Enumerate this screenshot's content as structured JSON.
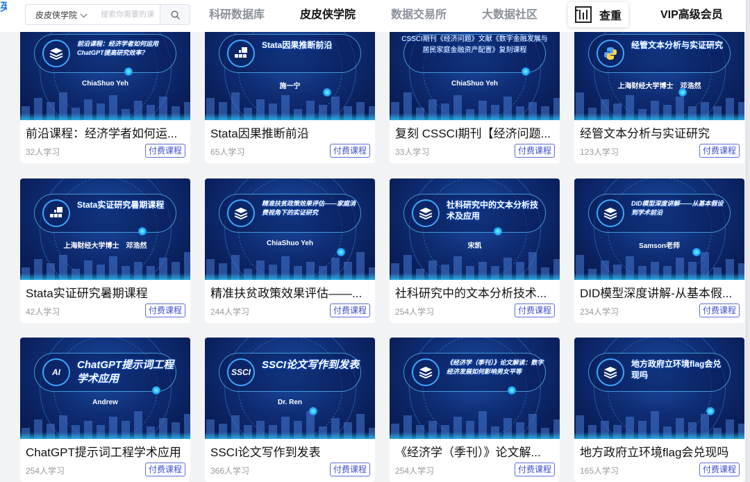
{
  "header": {
    "logo_fragment": "英入",
    "site_select": "皮皮侠学院",
    "search_placeholder": "搜索你需要的课",
    "nav": {
      "research": "科研数据库",
      "academy": "皮皮侠学院",
      "data_market": "数据交易所",
      "community": "大数据社区",
      "check": "查重",
      "vip": "VIP高级会员"
    }
  },
  "colors": {
    "accent_blue": "#3c4fc8",
    "thumb_dark": "#07164a",
    "thumb_light": "#1c4fa8"
  },
  "courses": [
    {
      "thumb_title": "前沿课程：经济学者如何运用ChatGPT提高研究效率？",
      "thumb_author": "ChiaShuo Yeh",
      "icon": "layers-icon",
      "title": "前沿课程：经济学者如何运...",
      "learners": "32人学习",
      "tag": "付费课程"
    },
    {
      "thumb_title": "Stata因果推断前沿",
      "thumb_author": "施一宁",
      "icon": "grid-icon",
      "title": "Stata因果推断前沿",
      "learners": "65人学习",
      "tag": "付费课程"
    },
    {
      "thumb_title": "CSSCI期刊《经济问题》文献《数字金融发展与居民家庭金融资产配置》复刻课程",
      "thumb_author": "ChiaShuo Yeh",
      "icon": "",
      "title": "复刻 CSSCI期刊【经济问题...",
      "learners": "33人学习",
      "tag": "付费课程"
    },
    {
      "thumb_title": "经管文本分析与实证研究",
      "thumb_author": "上海财经大学博士　邓浩然",
      "icon": "python-icon",
      "title": "经管文本分析与实证研究",
      "learners": "123人学习",
      "tag": "付费课程"
    },
    {
      "thumb_title": "Stata实证研究暑期课程",
      "thumb_author": "上海财经大学博士　邓浩然",
      "icon": "grid-icon",
      "title": "Stata实证研究暑期课程",
      "learners": "42人学习",
      "tag": "付费课程"
    },
    {
      "thumb_title": "精准扶贫政策效果评估——家庭消费视角下的实证研究",
      "thumb_author": "ChiaShuo Yeh",
      "icon": "layers-icon",
      "title": "精准扶贫政策效果评估——...",
      "learners": "244人学习",
      "tag": "付费课程"
    },
    {
      "thumb_title": "社科研究中的文本分析技术及应用",
      "thumb_author": "宋凯",
      "icon": "layers-icon",
      "title": "社科研究中的文本分析技术...",
      "learners": "254人学习",
      "tag": "付费课程"
    },
    {
      "thumb_title": "DID模型深度讲解——从基本假设到学术前沿",
      "thumb_author": "Samson老师",
      "icon": "layers-icon",
      "title": "DID模型深度讲解-从基本假...",
      "learners": "234人学习",
      "tag": "付费课程"
    },
    {
      "thumb_title": "ChatGPT提示词工程学术应用",
      "thumb_author": "Andrew",
      "icon": "ai-icon",
      "badge_text": "AI",
      "title": "ChatGPT提示词工程学术应用",
      "learners": "254人学习",
      "tag": "付费课程"
    },
    {
      "thumb_title": "SSCI论文写作到发表",
      "thumb_author": "Dr. Ren",
      "icon": "ssci-icon",
      "badge_text": "SSCI",
      "title": "SSCI论文写作到发表",
      "learners": "366人学习",
      "tag": "付费课程"
    },
    {
      "thumb_title": "《经济学（季刊）》论文解读：数字经济发展如何影响男女平等",
      "thumb_author": "",
      "icon": "layers-icon",
      "title": "《经济学（季刊）》论文解...",
      "learners": "254人学习",
      "tag": "付费课程"
    },
    {
      "thumb_title": "地方政府立环境flag会兑现吗",
      "thumb_author": "",
      "icon": "layers-icon",
      "title": "地方政府立环境flag会兑现吗",
      "learners": "165人学习",
      "tag": "付费课程"
    }
  ]
}
